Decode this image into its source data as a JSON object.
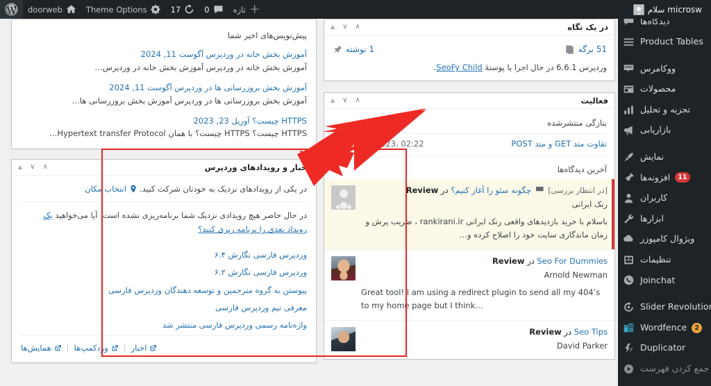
{
  "adminbar": {
    "greeting": "سلام microsw",
    "site_name": "doorweb",
    "theme_options": "Theme Options",
    "updates_count": "17",
    "comments_count": "0",
    "new_label": "تازه",
    "icons": {
      "wordpress": "wordpress-logo-icon",
      "home": "home-icon",
      "gear": "gear-icon",
      "updates": "updates-icon",
      "comment": "comment-bubble-icon",
      "plus": "plus-icon",
      "avatar": "user-avatar-icon"
    }
  },
  "sidebar": {
    "items": [
      {
        "label": "دیدگاه‌ها",
        "icon": "comment-bubble-icon",
        "badge": ""
      },
      {
        "label": "Product Tables",
        "icon": "hamburger-menu-icon",
        "badge": ""
      },
      {
        "label": "ووکامرس",
        "icon": "woocommerce-icon",
        "badge": ""
      },
      {
        "label": "محصولات",
        "icon": "products-box-icon",
        "badge": ""
      },
      {
        "label": "تجزیه و تحلیل",
        "icon": "bar-chart-icon",
        "badge": ""
      },
      {
        "label": "بازاریابی",
        "icon": "megaphone-icon",
        "badge": ""
      },
      {
        "label": "نمایش",
        "icon": "appearance-brush-icon",
        "badge": ""
      },
      {
        "label": "افزونه‌ها",
        "icon": "plugin-icon",
        "badge": "11"
      },
      {
        "label": "کاربران",
        "icon": "users-icon",
        "badge": ""
      },
      {
        "label": "ابزارها",
        "icon": "tools-wrench-icon",
        "badge": ""
      },
      {
        "label": "ویژوال کامپوزر",
        "icon": "visual-composer-icon",
        "badge": ""
      },
      {
        "label": "تنظیمات",
        "icon": "settings-sliders-icon",
        "badge": ""
      },
      {
        "label": "Joinchat",
        "icon": "joinchat-whatsapp-icon",
        "badge": ""
      },
      {
        "label": "Slider Revolution",
        "icon": "slider-revolution-icon",
        "badge": ""
      },
      {
        "label": "Wordfence",
        "icon": "wordfence-icon",
        "badge": "2"
      },
      {
        "label": "Duplicator",
        "icon": "duplicator-icon",
        "badge": ""
      },
      {
        "label": "جمع کردن فهرست",
        "icon": "collapse-menu-icon",
        "badge": ""
      }
    ]
  },
  "glance": {
    "title": "در یک نگاه",
    "posts": "1 نوشته",
    "pages": "51 برگه",
    "version_prefix": "وردپرس 6.6.1 در حال اجرا با پوستهٔ",
    "theme_link": "SeoFy Child",
    "version_suffix": "."
  },
  "activity": {
    "title": "فعالیت",
    "recent_published_label": "بتازگی منتشرشده",
    "recent": [
      {
        "date": "آوریل 22nd 2023، 02:22",
        "title": "تفاوت متد GET و متد POST"
      }
    ],
    "latest_comments_label": "آخرین دیدگاه‌ها",
    "comments": [
      {
        "author": "رنک ایرانی",
        "post": "چگونه سئو را آغاز کنیم؟",
        "prefix": "Review",
        "in": "در",
        "status": "[در انتظار بررسی]",
        "text": "باسلام با خرید بازدیدهای واقعی رنک ایرانی rankirani.ir ، ضریب پرش و زمان ماندگاری سایت خود را اصلاح کرده و…",
        "pending": true,
        "avatar": "placeholder-avatar"
      },
      {
        "author": "Arnold Newman",
        "post": "Seo For Dummies",
        "prefix": "Review",
        "in": "در",
        "status": "",
        "text": "Great tool! I am using a redirect plugin to send all my 404’s to my home page but I think…",
        "pending": false,
        "avatar": "photo-avatar-1"
      },
      {
        "author": "David Parker",
        "post": "Seo Tips",
        "prefix": "Review",
        "in": "در",
        "status": "",
        "text": "",
        "pending": false,
        "avatar": "photo-avatar-2"
      }
    ]
  },
  "drafts": {
    "title": "پیش‌نویس‌های اخیر شما",
    "items": [
      {
        "title": "آموزش بخش خانه در وردپرس",
        "date": "آگوست 11, 2024",
        "excerpt": "آموزش بخش خانه در وردپرس آموزش بخش خانه در وردپرس…"
      },
      {
        "title": "آموزش بخش بروزرسانی ها در وردپرس",
        "date": "آگوست 11, 2024",
        "excerpt": "آموزش بخش بروزرسانی ها در وردپرس آموزش بخش بروزرسانی ها…"
      },
      {
        "title": "HTTPS چیست؟",
        "date": "آوریل 23, 2023",
        "excerpt": "HTTPS چیست؟ HTTPS چیست؟ با همان Hypertext transfer Protocol…"
      }
    ]
  },
  "news": {
    "title": "اخبار و رویدادهای وردپرس",
    "lead_text": "در یکی از رویدادهای نزدیک به خودتان شرکت کنید.",
    "choose_location": "انتخاب مکان",
    "location_icon": "map-pin-icon",
    "no_events_text": "در حال حاضر هیچ رویدادی نزدیک شما برنامه‌ریزی نشده است. آیا می‌خواهید",
    "no_events_link": "یک رویداد بعدی را برنامه ریزی کنید؟",
    "links": [
      "وردپرس فارسی نگارش ۶.۴",
      "وردپرس فارسی نگارش ۶.۲",
      "پیوستن به گروه مترجمین و توسعه دهندگان وردپرس فارسی",
      "معرفی تیم وردپرس فارسی",
      "واژه‌نامه رسمی وردپرس فارسی منتشر شد"
    ],
    "footer": {
      "meetups": "همایش‌ها",
      "wordcamps": "وردکمپ‌ها",
      "news": "اخبار",
      "external_icon": "external-link-icon"
    }
  },
  "panel_controls": {
    "order_up": "order-higher-icon",
    "toggle_down": "toggle-panel-down-icon",
    "toggle_up": "toggle-panel-up-icon"
  },
  "annotation": {
    "highlight_color": "#e8251f",
    "arrow_color": "#ee2a24",
    "arrow_icon": "red-pointer-arrow"
  }
}
